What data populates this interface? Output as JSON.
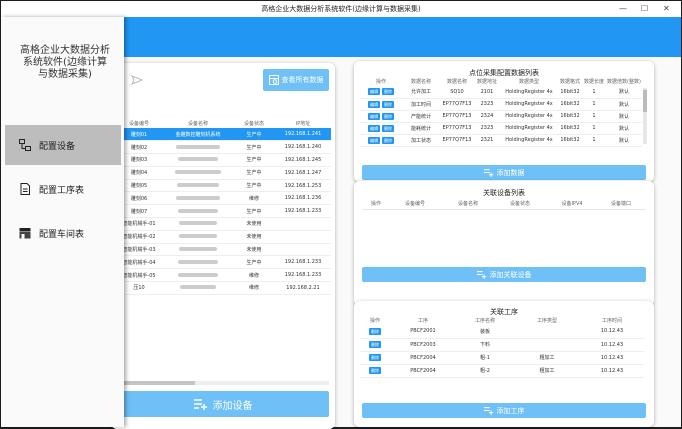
{
  "window": {
    "title": "高格企业大数据分析系统软件(边缘计算与数据采集)",
    "minimize": "—",
    "maximize": "☐",
    "close": "✕"
  },
  "sidebar": {
    "app_title": "高格企业大数据分析系统软件(边缘计算与数据采集)",
    "items": [
      {
        "label": "配置设备",
        "icon": "device-config-icon",
        "active": true
      },
      {
        "label": "配置工序表",
        "icon": "process-table-icon",
        "active": false
      },
      {
        "label": "配置车间表",
        "icon": "workshop-table-icon",
        "active": false
      }
    ]
  },
  "devices_panel": {
    "send_icon": "send-icon",
    "query_all_label": "查看所有数据",
    "columns": [
      "设备编号",
      "设备名称",
      "设备状态",
      "IP地址"
    ],
    "rows": [
      {
        "code": "雕刻01",
        "name": "金雕数控雕刻机系统",
        "status": "生产中",
        "ip": "192.168.1.241",
        "selected": true
      },
      {
        "code": "雕刻02",
        "name": "",
        "status": "生产中",
        "ip": "192.168.1.240"
      },
      {
        "code": "雕刻03",
        "name": "",
        "status": "生产中",
        "ip": "192.168.1.245"
      },
      {
        "code": "雕刻04",
        "name": "",
        "status": "生产中",
        "ip": "192.168.1.247"
      },
      {
        "code": "雕刻05",
        "name": "",
        "status": "生产中",
        "ip": "192.168.1.253"
      },
      {
        "code": "雕刻06",
        "name": "",
        "status": "维修",
        "ip": "192.168.1.236"
      },
      {
        "code": "雕刻07",
        "name": "",
        "status": "生产中",
        "ip": "192.168.1.233"
      },
      {
        "code": "智能机械手-01",
        "name": "",
        "status": "未使用",
        "ip": ""
      },
      {
        "code": "智能机械手-02",
        "name": "",
        "status": "未使用",
        "ip": ""
      },
      {
        "code": "智能机械手-03",
        "name": "",
        "status": "未使用",
        "ip": ""
      },
      {
        "code": "智能机械手-04",
        "name": "",
        "status": "生产中",
        "ip": "192.168.1.233"
      },
      {
        "code": "智能机械手-05",
        "name": "",
        "status": "维修",
        "ip": "192.168.1.233"
      },
      {
        "code": "压10",
        "name": "",
        "status": "维修",
        "ip": "192.168.2.21"
      }
    ],
    "add_device_label": "添加设备",
    "add_icon": "playlist-add-icon"
  },
  "data_points_panel": {
    "title": "点位采集配置数据列表",
    "columns": [
      "操作",
      "数据名称",
      "数据名称",
      "数据地址",
      "数据类型",
      "数据格式",
      "数据长度",
      "数据倍数(整数)"
    ],
    "edit_label": "编辑",
    "delete_label": "删除",
    "rows": [
      [
        "允许加工",
        "SQ10",
        "2101",
        "HoldingRegister 4x",
        "16bit32",
        "1",
        "1",
        "默认"
      ],
      [
        "加工时间",
        "EP77Q7F13",
        "2323",
        "HoldingRegister 4x",
        "16bit32",
        "1",
        "1",
        "默认"
      ],
      [
        "产能统计",
        "EP77Q7F13",
        "2324",
        "HoldingRegister 4x",
        "16bit32",
        "1",
        "1",
        "默认"
      ],
      [
        "能耗统计",
        "EP77Q7F13",
        "2323",
        "HoldingRegister 4x",
        "16bit32",
        "1",
        "1",
        "默认"
      ],
      [
        "加工状态",
        "EP77Q7F13",
        "2321",
        "HoldingRegister 4x",
        "16bit32",
        "1",
        "1",
        "默认"
      ]
    ],
    "add_label": "添加数据"
  },
  "associated_devices_panel": {
    "title": "关联设备列表",
    "columns": [
      "操作",
      "设备编号",
      "设备名称",
      "设备状态",
      "设备IPV4",
      "设备端口"
    ],
    "add_label": "添加关联设备"
  },
  "processes_panel": {
    "title": "关联工序",
    "columns": [
      "操作",
      "工序",
      "工序名称",
      "工序类型",
      "工序时间"
    ],
    "delete_label": "删除",
    "rows": [
      [
        "PBCF2001",
        "装板",
        "",
        "10.12.43"
      ],
      [
        "PBCF2003",
        "下料",
        "",
        "10.12.43"
      ],
      [
        "PBCF2004",
        "粗-1",
        "粗加工",
        "10.12.43"
      ],
      [
        "PBCF2004",
        "粗-2",
        "粗加工",
        "10.12.43"
      ]
    ],
    "add_label": "添加工序"
  }
}
